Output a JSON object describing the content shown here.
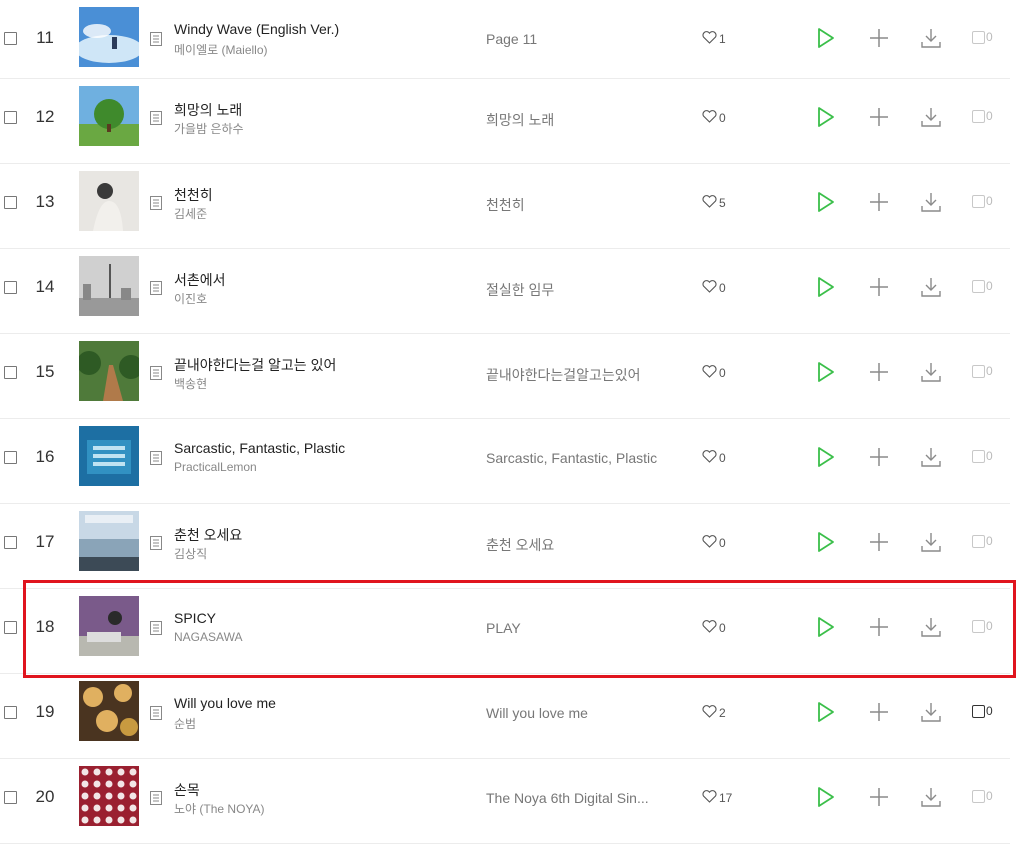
{
  "rows": [
    {
      "rank": "11",
      "title": "Windy Wave (English Ver.)",
      "artist": "메이엘로 (Maiello)",
      "album": "Page 11",
      "likes": "1",
      "vote_count": "0",
      "vote_active": false,
      "art": {
        "colors": [
          "#4a8fd6",
          "#cfe6f7"
        ],
        "motif": "sky"
      }
    },
    {
      "rank": "12",
      "title": "희망의 노래",
      "artist": "가을밤 은하수",
      "album": "희망의 노래",
      "likes": "0",
      "vote_count": "0",
      "vote_active": false,
      "art": {
        "colors": [
          "#6fb0e0",
          "#6aa842"
        ],
        "motif": "tree"
      }
    },
    {
      "rank": "13",
      "title": "천천히",
      "artist": "김세준",
      "album": "천천히",
      "likes": "5",
      "vote_count": "0",
      "vote_active": false,
      "art": {
        "colors": [
          "#e8e6e2",
          "#3a3a3a"
        ],
        "motif": "person"
      }
    },
    {
      "rank": "14",
      "title": "서촌에서",
      "artist": "이진호",
      "album": "절실한 임무",
      "likes": "0",
      "vote_count": "0",
      "vote_active": false,
      "art": {
        "colors": [
          "#d0d0d0",
          "#555555"
        ],
        "motif": "lamp"
      }
    },
    {
      "rank": "15",
      "title": "끝내야한다는걸 알고는 있어",
      "artist": "백송현",
      "album": "끝내야한다는걸알고는있어",
      "likes": "0",
      "vote_count": "0",
      "vote_active": false,
      "art": {
        "colors": [
          "#4f7a3a",
          "#b07a4a"
        ],
        "motif": "path"
      }
    },
    {
      "rank": "16",
      "title": "Sarcastic, Fantastic, Plastic",
      "artist": "PracticalLemon",
      "album": "Sarcastic, Fantastic, Plastic",
      "likes": "0",
      "vote_count": "0",
      "vote_active": false,
      "art": {
        "colors": [
          "#1d6fa3",
          "#3aa0cf"
        ],
        "motif": "cube"
      }
    },
    {
      "rank": "17",
      "title": "춘천 오세요",
      "artist": "김상직",
      "album": "춘천 오세요",
      "likes": "0",
      "vote_count": "0",
      "vote_active": false,
      "art": {
        "colors": [
          "#c8d8e6",
          "#3c4a56"
        ],
        "motif": "lake"
      }
    },
    {
      "rank": "18",
      "title": "SPICY",
      "artist": "NAGASAWA",
      "album": "PLAY",
      "likes": "0",
      "vote_count": "0",
      "vote_active": false,
      "art": {
        "colors": [
          "#7a5a8a",
          "#b8b8b0"
        ],
        "motif": "room"
      }
    },
    {
      "rank": "19",
      "title": "Will you love me",
      "artist": "순범",
      "album": "Will you love me",
      "likes": "2",
      "vote_count": "0",
      "vote_active": true,
      "art": {
        "colors": [
          "#4a3420",
          "#e0b060"
        ],
        "motif": "flowers"
      }
    },
    {
      "rank": "20",
      "title": "손목",
      "artist": "노야 (The NOYA)",
      "album": "The Noya 6th Digital Sin...",
      "likes": "17",
      "vote_count": "0",
      "vote_active": false,
      "art": {
        "colors": [
          "#9a2030",
          "#f2e6e6"
        ],
        "motif": "dots"
      }
    }
  ],
  "colors": {
    "play": "#3bbf4a",
    "icon": "#8a8a8a",
    "highlight": "#e0141e"
  },
  "icons": {
    "doc": "lyrics-doc-icon",
    "like": "heart-icon",
    "play": "play-icon",
    "add": "plus-icon",
    "download": "download-icon"
  }
}
